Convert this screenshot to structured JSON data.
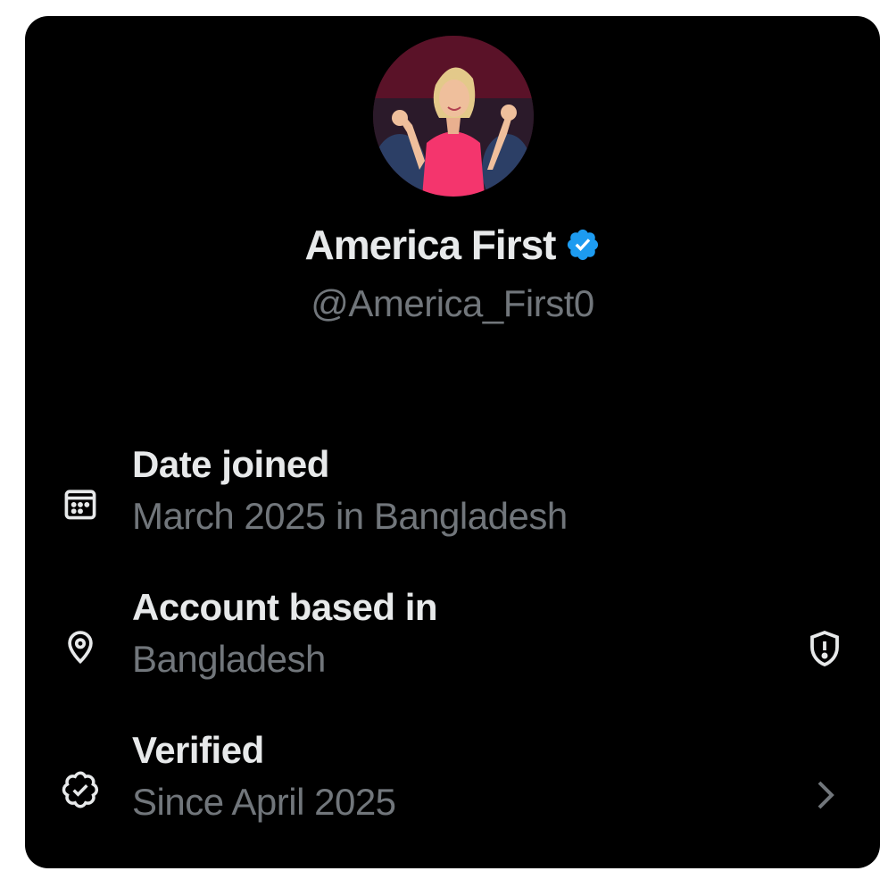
{
  "profile": {
    "display_name": "America First",
    "handle": "@America_First0",
    "verified": true,
    "avatar": "profile-photo"
  },
  "info": {
    "date_joined": {
      "icon": "calendar-icon",
      "title": "Date joined",
      "value": "March 2025 in Bangladesh"
    },
    "account_based_in": {
      "icon": "location-pin-icon",
      "title": "Account based in",
      "value": "Bangladesh",
      "action_icon": "shield-alert-icon"
    },
    "verified": {
      "icon": "verified-check-icon",
      "title": "Verified",
      "value": "Since April 2025",
      "action_icon": "chevron-right-icon"
    }
  },
  "colors": {
    "background": "#000000",
    "primary_text": "#e7e9ea",
    "secondary_text": "#71767b",
    "verified_blue": "#1d9bf0"
  }
}
